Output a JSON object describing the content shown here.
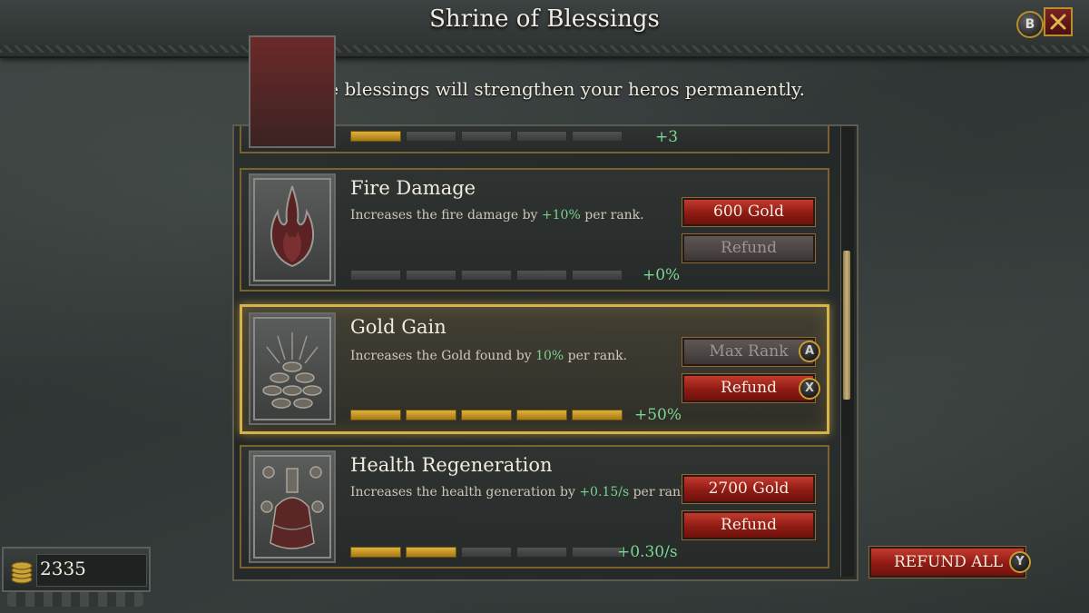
{
  "header": {
    "title": "Shrine of Blessings",
    "b_button": "B",
    "close_icon": "close-x-icon"
  },
  "subtitle": "These blessings will strengthen your heros permanently.",
  "blessings": [
    {
      "name": "",
      "bonus": "+3",
      "ranks_filled": 1,
      "ranks_total": 5,
      "partial": true
    },
    {
      "name": "Fire Damage",
      "desc_pre": "Increases the fire damage by ",
      "desc_hl": "+10%",
      "desc_post": " per rank.",
      "primary": "600 Gold",
      "secondary": "Refund",
      "bonus": "+0%",
      "ranks_filled": 0,
      "ranks_total": 5
    },
    {
      "name": "Gold Gain",
      "desc_pre": "Increases the Gold found by ",
      "desc_hl": "10%",
      "desc_post": " per rank.",
      "primary": "Max Rank",
      "secondary": "Refund",
      "primary_hint": "A",
      "secondary_hint": "X",
      "bonus": "+50%",
      "ranks_filled": 5,
      "ranks_total": 5,
      "selected": true
    },
    {
      "name": "Health Regeneration",
      "desc_pre": "Increases the health generation by ",
      "desc_hl": "+0.15/s",
      "desc_post": " per rank.",
      "primary": "2700 Gold",
      "secondary": "Refund",
      "bonus": "+0.30/s",
      "ranks_filled": 2,
      "ranks_total": 5
    }
  ],
  "footer": {
    "gold": "2335",
    "refund_all": "REFUND ALL",
    "refund_all_hint": "Y"
  },
  "colors": {
    "accent_gold": "#d6b24a",
    "button_red": "#a3241a",
    "bonus_green": "#7dd694"
  }
}
